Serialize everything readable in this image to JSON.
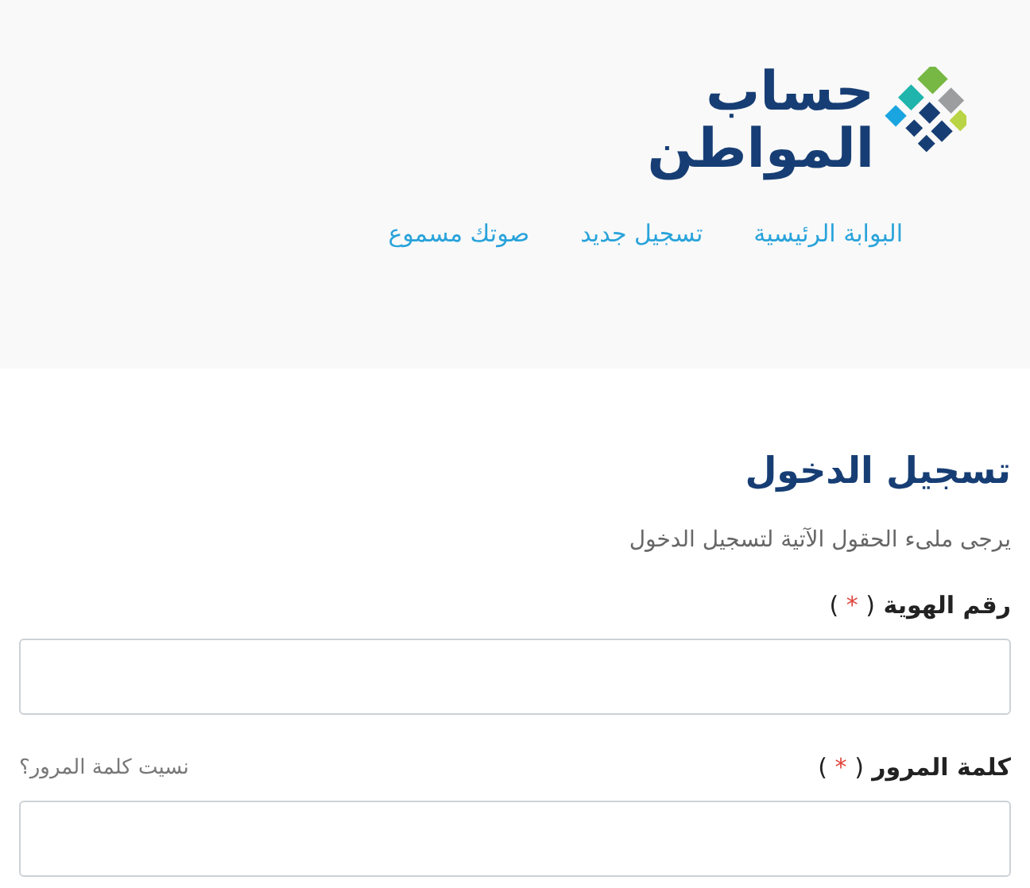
{
  "logo": {
    "line_1": "حساب",
    "line_2": "المواطن"
  },
  "nav": [
    {
      "label": "البوابة الرئيسية"
    },
    {
      "label": "تسجيل جديد"
    },
    {
      "label": "صوتك مسموع"
    }
  ],
  "login": {
    "title": "تسجيل الدخول",
    "subtitle": "يرجى ملىء الحقول الآتية لتسجيل الدخول",
    "fields": [
      {
        "label": "رقم الهوية",
        "required": {
          "open": "(",
          "star": "*",
          "close": ")"
        }
      },
      {
        "label": "كلمة المرور",
        "required": {
          "open": "(",
          "star": "*",
          "close": ")"
        },
        "link": "نسيت كلمة المرور؟"
      }
    ]
  }
}
